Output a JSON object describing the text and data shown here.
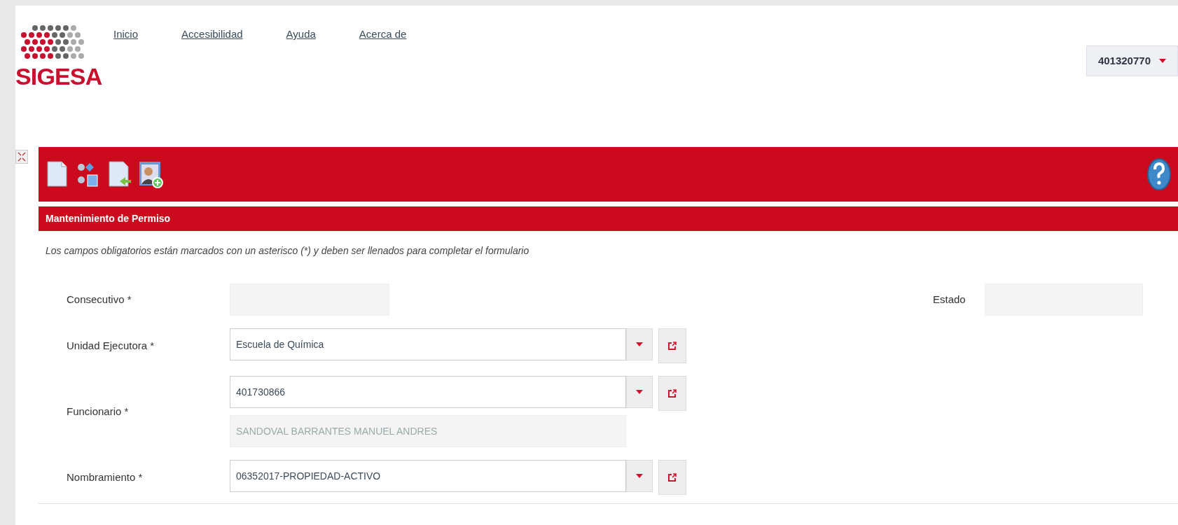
{
  "logo": {
    "text": "SIGESA"
  },
  "nav": [
    {
      "label": "Inicio"
    },
    {
      "label": "Accesibilidad"
    },
    {
      "label": "Ayuda"
    },
    {
      "label": "Acerca de"
    }
  ],
  "user_menu": {
    "label": "401320770"
  },
  "toolbar": {
    "buttons": [
      {
        "kind": "new"
      },
      {
        "kind": "workflow"
      },
      {
        "kind": "back"
      },
      {
        "kind": "add-user"
      }
    ]
  },
  "panel": {
    "title": "Mantenimiento de Permiso",
    "instruction": "Los campos obligatorios están marcados con un asterisco (*) y deben ser llenados para completar el formulario",
    "fields": [
      {
        "kind": "pair",
        "label": "Consecutivo *",
        "disabled": true,
        "right_label": "Estado",
        "right_disabled": true
      },
      {
        "kind": "select",
        "label": "Unidad Ejecutora *",
        "value": "Escuela de Química"
      },
      {
        "kind": "select",
        "label": "Funcionario *",
        "value": "401730866",
        "detail": "SANDOVAL BARRANTES MANUEL ANDRES"
      },
      {
        "kind": "select",
        "label": "Nombramiento *",
        "value": "06352017-PROPIEDAD-ACTIVO"
      }
    ]
  }
}
